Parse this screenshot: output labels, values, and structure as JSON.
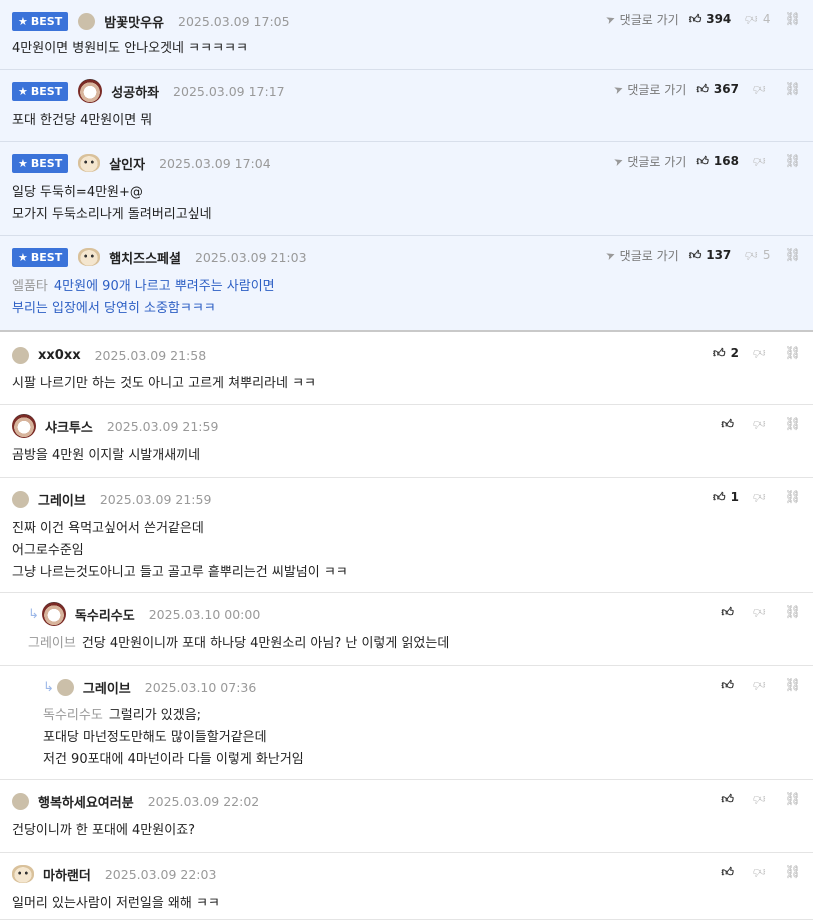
{
  "labels": {
    "best": "BEST",
    "goto": "댓글로 가기"
  },
  "comments": [
    {
      "badge": true,
      "nick": "밤꽃맛우유",
      "date": "2025.03.09 17:05",
      "up": "394",
      "down": "4",
      "lines": [
        "4만원이면 병원비도 안나오겟네 ㅋㅋㅋㅋㅋ"
      ]
    },
    {
      "badge": true,
      "nick": "성공하좌",
      "date": "2025.03.09 17:17",
      "up": "367",
      "down": "",
      "lines": [
        "포대 한건당 4만원이면 뭐"
      ]
    },
    {
      "badge": true,
      "nick": "살인자",
      "date": "2025.03.09 17:04",
      "up": "168",
      "down": "",
      "lines": [
        "일당 두둑히=4만원+@",
        "모가지 두둑소리나게 돌려버리고싶네"
      ]
    },
    {
      "badge": true,
      "nick": "햄치즈스페셜",
      "date": "2025.03.09 21:03",
      "up": "137",
      "down": "5",
      "ref": "엘품타",
      "lines": [
        "4만원에 90개 나르고 뿌려주는 사람이면",
        "부리는 입장에서 당연히 소중함ㅋㅋㅋ"
      ]
    },
    {
      "nick": "xx0xx",
      "date": "2025.03.09 21:58",
      "up": "2",
      "down": "",
      "lines": [
        "시팔 나르기만 하는 것도 아니고 고르게 쳐뿌리라네 ㅋㅋ"
      ]
    },
    {
      "nick": "샤크투스",
      "date": "2025.03.09 21:59",
      "up": "",
      "down": "",
      "lines": [
        "곰방을 4만원 이지랄 시발개새끼네"
      ]
    },
    {
      "nick": "그레이브",
      "date": "2025.03.09 21:59",
      "up": "1",
      "down": "",
      "lines": [
        "진짜 이건 욕먹고싶어서 쓴거같은데",
        "어그로수준임",
        "그냥 나르는것도아니고 들고 골고루 흩뿌리는건 씨발넘이 ㅋㅋ"
      ]
    },
    {
      "nick": "독수리수도",
      "date": "2025.03.10 00:00",
      "up": "",
      "down": "",
      "ref": "그레이브",
      "lines": [
        "건당 4만원이니까 포대 하나당 4만원소리 아님? 난 이렇게 읽었는데"
      ]
    },
    {
      "nick": "그레이브",
      "date": "2025.03.10 07:36",
      "up": "",
      "down": "",
      "ref": "독수리수도",
      "lines": [
        "그럴리가 있겠음;",
        "포대당 마넌정도만해도 많이들할거같은데",
        "저건 90포대에 4마넌이라 다들 이렇게 화난거임"
      ]
    },
    {
      "nick": "행복하세요여러분",
      "date": "2025.03.09 22:02",
      "up": "",
      "down": "",
      "lines": [
        "건당이니까 한 포대에 4만원이죠?"
      ]
    },
    {
      "nick": "마하랜더",
      "date": "2025.03.09 22:03",
      "up": "",
      "down": "",
      "lines": [
        "일머리 있는사람이 저런일을 왜해 ㅋㅋ"
      ]
    }
  ]
}
